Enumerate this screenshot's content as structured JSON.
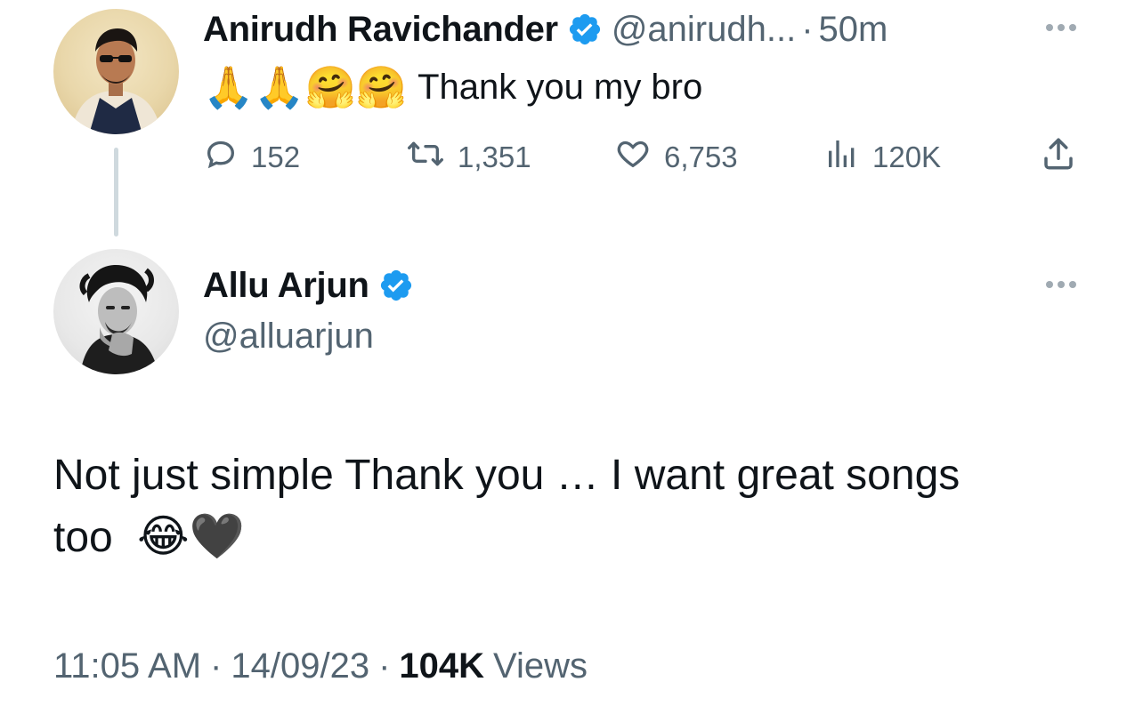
{
  "parent_tweet": {
    "display_name": "Anirudh Ravichander",
    "handle": "@anirudh...",
    "separator": "·",
    "time_ago": "50m",
    "text_emojis": "🙏🙏🤗🤗",
    "text": "Thank you my bro",
    "actions": {
      "replies": "152",
      "retweets": "1,351",
      "likes": "6,753",
      "views": "120K"
    }
  },
  "main_tweet": {
    "display_name": "Allu Arjun",
    "handle": "@alluarjun",
    "text_line1": "Not just simple Thank you … I want great songs",
    "text_line2": "too",
    "text_emojis": "😂🖤",
    "time": "11:05 AM",
    "separator": "·",
    "date": "14/09/23",
    "view_count": "104K",
    "views_label": "Views"
  },
  "colors": {
    "verified_blue": "#1d9bf0",
    "muted_text": "#536471",
    "primary_text": "#0f1419",
    "thread_line": "#cfd9de"
  }
}
